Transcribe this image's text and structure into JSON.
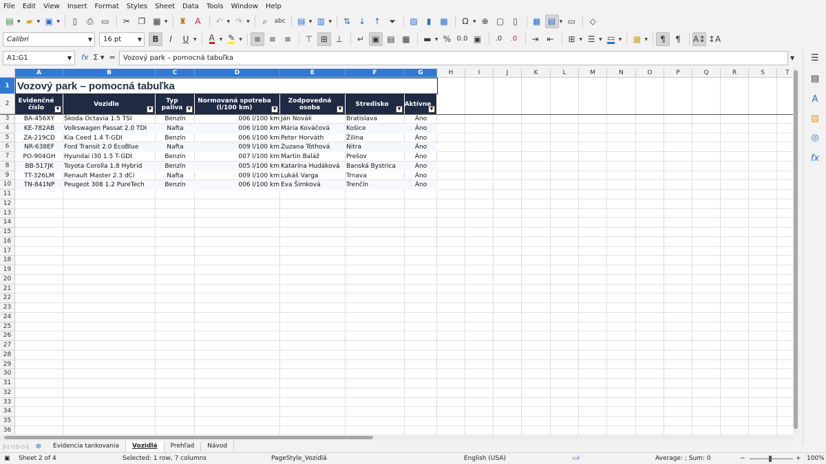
{
  "menu": [
    "File",
    "Edit",
    "View",
    "Insert",
    "Format",
    "Styles",
    "Sheet",
    "Data",
    "Tools",
    "Window",
    "Help"
  ],
  "formatting": {
    "font_name": "Calibri",
    "font_size": "16 pt"
  },
  "formula_bar": {
    "name_box": "A1:G1",
    "content": "Vozový park – pomocná tabuľka"
  },
  "columns": [
    "A",
    "B",
    "C",
    "D",
    "E",
    "F",
    "G",
    "H",
    "I",
    "J",
    "K",
    "L",
    "M",
    "N",
    "O",
    "P",
    "Q",
    "R",
    "S",
    "T"
  ],
  "rows": [
    "1",
    "2",
    "3",
    "4",
    "5",
    "6",
    "7",
    "8",
    "9",
    "10",
    "11",
    "12",
    "13",
    "14",
    "15",
    "16",
    "17",
    "18",
    "19",
    "20",
    "21",
    "22",
    "23",
    "24",
    "25",
    "26",
    "27",
    "28",
    "29",
    "30",
    "31",
    "32",
    "33",
    "34",
    "35",
    "36"
  ],
  "sheet": {
    "title": "Vozový park – pomocná tabuľka",
    "headers": [
      {
        "line1": "Evidenčné",
        "line2": "číslo"
      },
      {
        "line1": "Vozidlo",
        "line2": ""
      },
      {
        "line1": "Typ paliva",
        "line2": ""
      },
      {
        "line1": "Normovaná spotreba",
        "line2": "(l/100 km)"
      },
      {
        "line1": "Zodpovedná osoba",
        "line2": ""
      },
      {
        "line1": "Stredisko",
        "line2": ""
      },
      {
        "line1": "Aktívne",
        "line2": ""
      }
    ],
    "data": [
      [
        "BA-456XY",
        "Škoda Octavia 1.5 TSI",
        "Benzín",
        "006 l/100 km",
        "Ján Novák",
        "Bratislava",
        "Áno"
      ],
      [
        "KE-782AB",
        "Volkswagen Passat 2.0 TDI",
        "Nafta",
        "006 l/100 km",
        "Mária Kováčová",
        "Košice",
        "Áno"
      ],
      [
        "ZA-219CD",
        "Kia Ceed 1.4 T-GDI",
        "Benzín",
        "006 l/100 km",
        "Peter Horváth",
        "Žilina",
        "Áno"
      ],
      [
        "NR-638EF",
        "Ford Transit 2.0 EcoBlue",
        "Nafta",
        "009 l/100 km",
        "Zuzana Tóthová",
        "Nitra",
        "Áno"
      ],
      [
        "PO-904GH",
        "Hyundai i30 1.5 T-GDI",
        "Benzín",
        "007 l/100 km",
        "Martin Baláž",
        "Prešov",
        "Áno"
      ],
      [
        "BB-517JK",
        "Toyota Corolla 1.8 Hybrid",
        "Benzín",
        "005 l/100 km",
        "Katarína Hudáková",
        "Banská Bystrica",
        "Áno"
      ],
      [
        "TT-326LM",
        "Renault Master 2.3 dCi",
        "Nafta",
        "009 l/100 km",
        "Lukáš Varga",
        "Trnava",
        "Áno"
      ],
      [
        "TN-841NP",
        "Peugeot 308 1.2 PureTech",
        "Benzín",
        "006 l/100 km",
        "Eva Šimková",
        "Trenčín",
        "Áno"
      ]
    ]
  },
  "tabs": [
    "Evidencia tankovania",
    "Vozidlá",
    "Prehľad",
    "Návod"
  ],
  "status": {
    "sheet": "Sheet 2 of 4",
    "selection": "Selected: 1 row, 7 columns",
    "page_style": "PageStyle_Vozidlá",
    "language": "English (USA)",
    "sum": "Average: ; Sum: 0",
    "zoom": "100%"
  }
}
